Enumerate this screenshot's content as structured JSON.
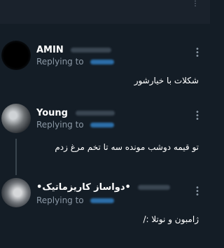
{
  "tweets": [
    {
      "name": "AMIN",
      "replying_label": "Replying to",
      "text": "شکلات با خیارشور"
    },
    {
      "name": "Young",
      "replying_label": "Replying to",
      "text": "تو قیمه دوشب مونده سه تا تخم مرغ زدم"
    },
    {
      "name": "•دواساز کاریزماتیک•",
      "replying_label": "Replying to",
      "text": "ژامبون و نوتلا :/"
    }
  ],
  "icons": {
    "more": "more-options-icon"
  },
  "colors": {
    "background": "#141d26",
    "secondary_text": "#8b98a5",
    "link_blue": "#2c6ea8"
  }
}
